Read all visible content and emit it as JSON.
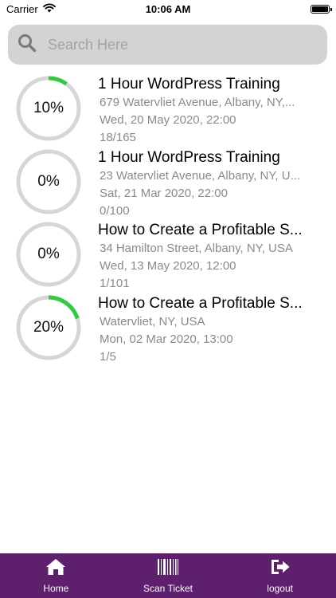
{
  "status_bar": {
    "carrier": "Carrier",
    "time": "10:06 AM"
  },
  "search": {
    "placeholder": "Search Here",
    "value": ""
  },
  "events": [
    {
      "progress_label": "10%",
      "progress": 0.1,
      "title": "1 Hour WordPress Training",
      "address": "679 Watervliet Avenue, Albany, NY,...",
      "datetime": "Wed, 20 May 2020, 22:00",
      "count": "18/165"
    },
    {
      "progress_label": "0%",
      "progress": 0.0,
      "title": "1 Hour WordPress Training",
      "address": "23 Watervliet Avenue, Albany, NY, U...",
      "datetime": "Sat, 21 Mar 2020, 22:00",
      "count": "0/100"
    },
    {
      "progress_label": "0%",
      "progress": 0.0,
      "title": "How to Create a Profitable S...",
      "address": "34 Hamilton Street, Albany, NY, USA",
      "datetime": "Wed, 13 May 2020, 12:00",
      "count": "1/101"
    },
    {
      "progress_label": "20%",
      "progress": 0.2,
      "title": "How to Create a Profitable S...",
      "address": "Watervliet, NY, USA",
      "datetime": "Mon, 02 Mar 2020, 13:00",
      "count": "1/5"
    }
  ],
  "tabs": {
    "home": "Home",
    "scan": "Scan Ticket",
    "logout": "logout"
  },
  "colors": {
    "tab_bar": "#5e1f6d",
    "ring_track": "#d6d6d6",
    "ring_progress": "#2ecc40",
    "search_bg": "#d3d3d3"
  }
}
